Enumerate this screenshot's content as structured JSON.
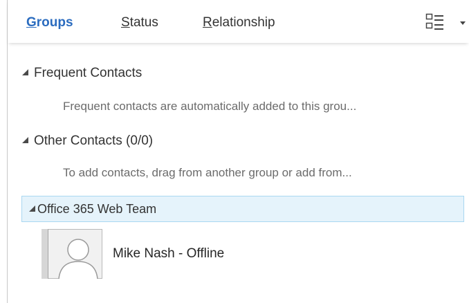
{
  "tabs": [
    {
      "key": "G",
      "rest": "roups",
      "active": true
    },
    {
      "key": "S",
      "rest": "tatus",
      "active": false
    },
    {
      "key": "R",
      "rest": "elationship",
      "active": false
    }
  ],
  "view_toggle_icon": "list-view-icon",
  "groups": {
    "frequent": {
      "title": "Frequent Contacts",
      "hint": "Frequent contacts are automatically added to this grou..."
    },
    "other": {
      "title": "Other  Contacts (0/0)",
      "hint": "To add contacts, drag from another group or add from..."
    },
    "office": {
      "title": "Office 365 Web Team",
      "contacts": [
        {
          "name": "Mike Nash - Offline",
          "presence": "offline"
        }
      ]
    }
  },
  "colors": {
    "accent": "#2b6cbf",
    "selected_bg": "#e5f3fb",
    "selected_border": "#a9d7f1",
    "hint_text": "#6b6b6b"
  }
}
